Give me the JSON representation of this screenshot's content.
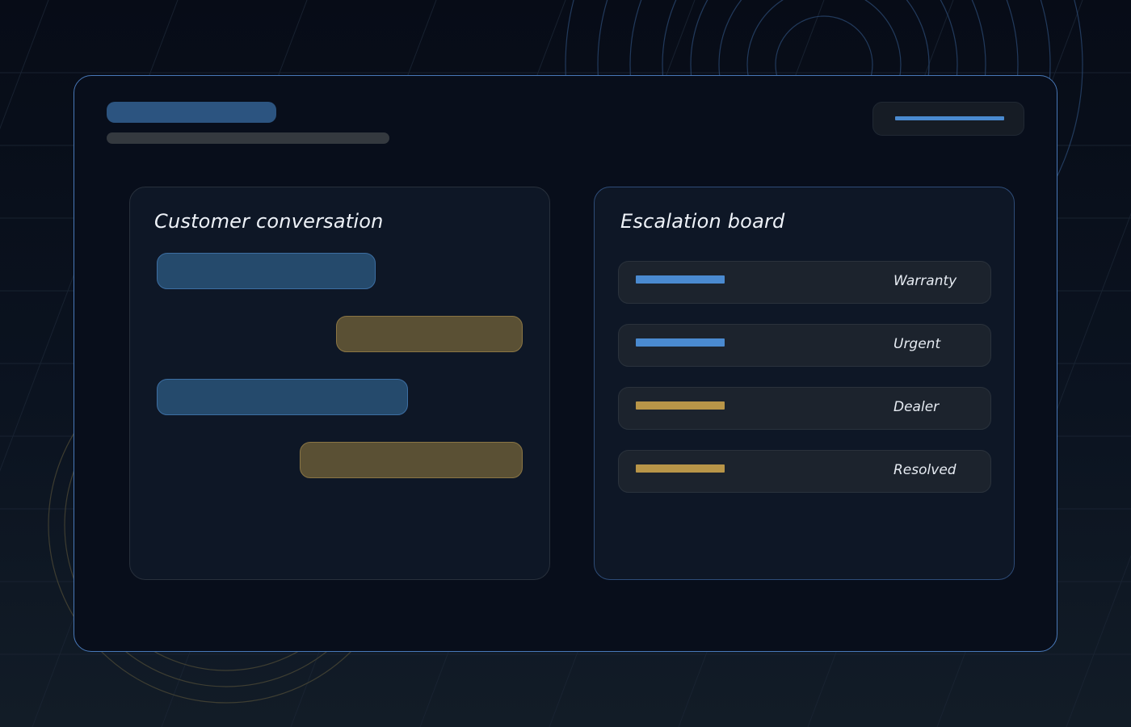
{
  "colors": {
    "accent_blue": "#4a8ad0",
    "accent_gold": "#b89548",
    "window_border": "#4878b8",
    "agent_bubble": "#254a6c",
    "customer_bubble": "#5a5034"
  },
  "conversation": {
    "title": "Customer conversation",
    "messages": [
      {
        "sender": "agent"
      },
      {
        "sender": "customer"
      },
      {
        "sender": "agent"
      },
      {
        "sender": "customer"
      }
    ]
  },
  "escalation": {
    "title": "Escalation board",
    "items": [
      {
        "label": "Warranty",
        "color": "#4a8ad0"
      },
      {
        "label": "Urgent",
        "color": "#4a8ad0"
      },
      {
        "label": "Dealer",
        "color": "#b89548"
      },
      {
        "label": "Resolved",
        "color": "#b89548"
      }
    ]
  }
}
